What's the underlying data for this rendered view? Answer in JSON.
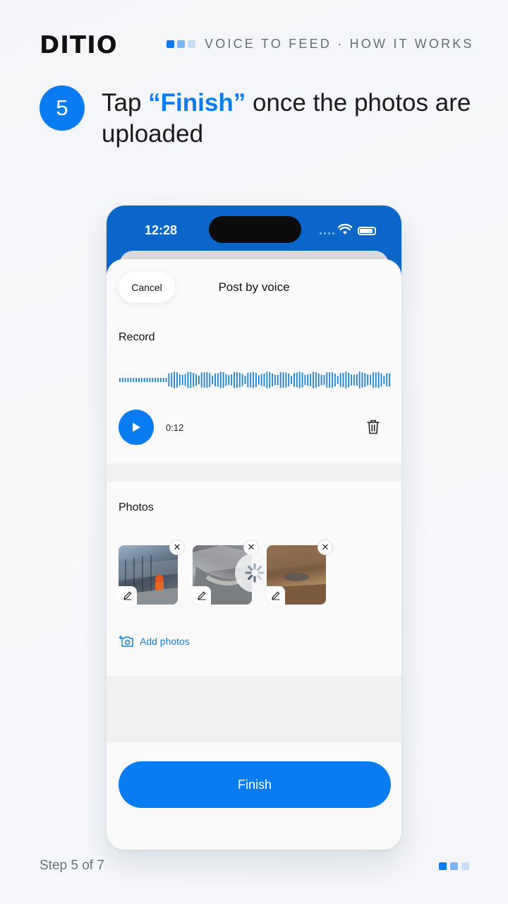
{
  "brand": {
    "logo": "DITIO"
  },
  "header": {
    "title": "VOICE TO FEED · HOW IT WORKS",
    "dot_colors": [
      "#0a7cf2",
      "#7cb4f5",
      "#c7ddf8"
    ]
  },
  "step": {
    "number": "5",
    "text_before": "Tap ",
    "highlight": "“Finish”",
    "text_after": " once the photos are uploaded"
  },
  "phone": {
    "time": "12:28",
    "sheet": {
      "cancel_label": "Cancel",
      "title": "Post by voice",
      "record_label": "Record",
      "duration": "0:12",
      "photos_label": "Photos",
      "photos": [
        {
          "name": "construction-site-photo",
          "uploading": false
        },
        {
          "name": "concrete-pour-photo",
          "uploading": true
        },
        {
          "name": "excavation-soil-photo",
          "uploading": false
        }
      ],
      "add_photos_label": "Add photos",
      "finish_label": "Finish"
    }
  },
  "footer": {
    "step_text": "Step 5 of 7",
    "dot_colors": [
      "#0a7cf2",
      "#7cb4f5",
      "#c7ddf8"
    ]
  },
  "colors": {
    "accent": "#0a7cf2",
    "status_bar": "#0a67c9"
  }
}
